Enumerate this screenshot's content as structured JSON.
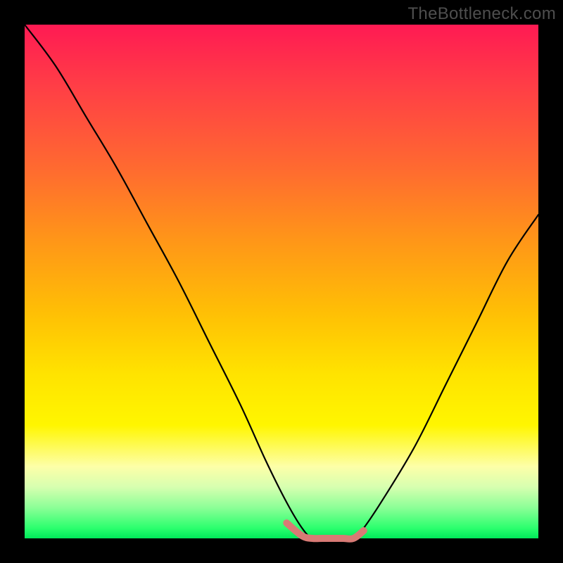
{
  "watermark": "TheBottleneck.com",
  "chart_data": {
    "type": "line",
    "title": "",
    "xlabel": "",
    "ylabel": "",
    "xlim": [
      0,
      100
    ],
    "ylim": [
      0,
      100
    ],
    "background_gradient": {
      "top": "#ff1a53",
      "bottom": "#00e85a",
      "meaning": "red high to green low (bottleneck severity)"
    },
    "series": [
      {
        "name": "bottleneck-curve",
        "color": "#000000",
        "x": [
          0,
          6,
          12,
          18,
          24,
          30,
          36,
          42,
          47,
          51,
          54,
          56,
          58,
          60,
          62,
          64,
          66,
          70,
          76,
          82,
          88,
          94,
          100
        ],
        "values": [
          100,
          92,
          82,
          72,
          61,
          50,
          38,
          26,
          15,
          7,
          2,
          0,
          0,
          0,
          0,
          0,
          2,
          8,
          18,
          30,
          42,
          54,
          63
        ]
      },
      {
        "name": "bottom-highlight",
        "color": "#d87a75",
        "x": [
          51,
          54,
          56,
          58,
          60,
          62,
          64,
          66
        ],
        "values": [
          3,
          0.5,
          0,
          0,
          0,
          0,
          0,
          1.5
        ]
      }
    ]
  }
}
